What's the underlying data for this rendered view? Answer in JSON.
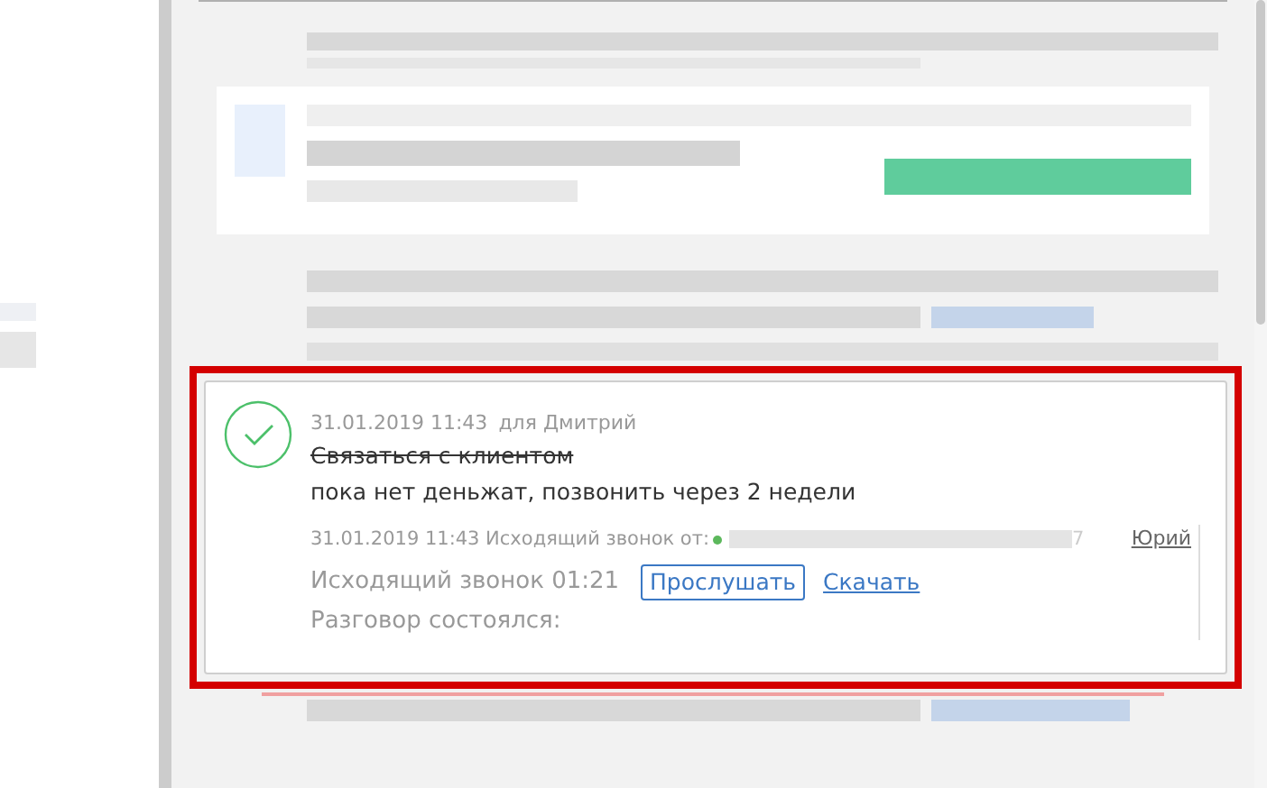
{
  "task": {
    "done": true,
    "datetime": "31.01.2019 11:43",
    "assignee": "для Дмитрий",
    "title": "Связаться с клиентом",
    "comment": "пока нет деньжат, позвонить через 2 недели"
  },
  "call": {
    "header": "31.01.2019 11:43 Исходящий звонок от:",
    "phone_tail": "7",
    "user": "Юрий",
    "summary": "Исходящий звонок 01:21",
    "listen": "Прослушать",
    "download": "Скачать",
    "result": "Разговор состоялся:"
  }
}
